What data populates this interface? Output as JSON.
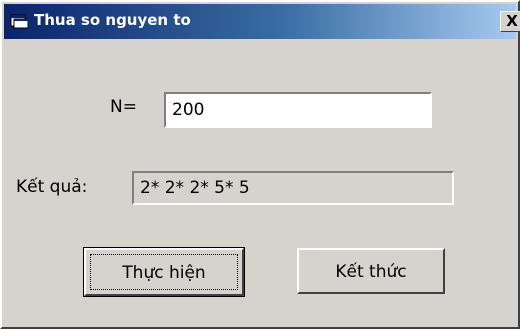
{
  "window": {
    "title": "Thua so nguyen to",
    "close_label": "X"
  },
  "form": {
    "n_label": "N=",
    "n_value": "200",
    "result_label": "Kết quả:",
    "result_value": "2* 2* 2* 5* 5"
  },
  "buttons": {
    "execute_label": "Thực hiện",
    "exit_label": "Kết thức"
  },
  "icons": {
    "app": "app-window-icon",
    "close": "close-icon"
  },
  "colors": {
    "face": "#d6d3ce",
    "title_start": "#0a246a",
    "title_end": "#a6caf0"
  }
}
